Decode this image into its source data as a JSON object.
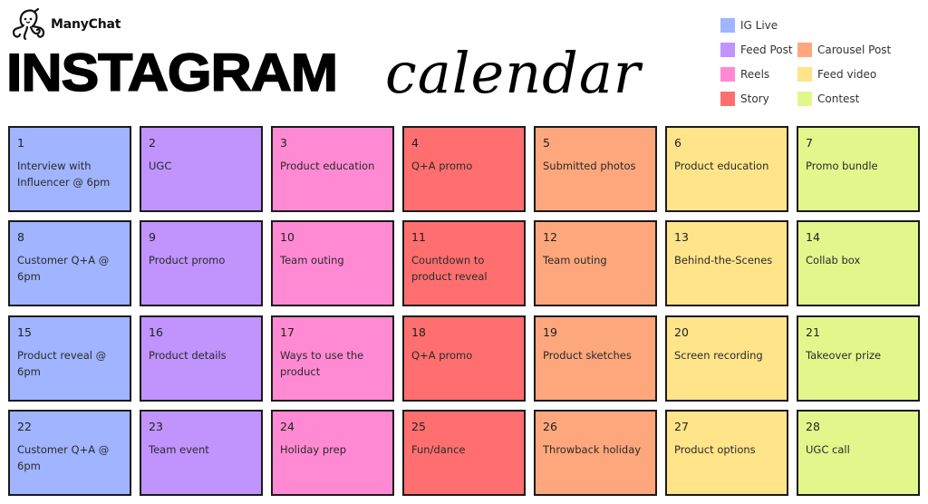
{
  "brand": {
    "name": "ManyChat"
  },
  "title": {
    "main": "INSTAGRAM",
    "script": "calendar"
  },
  "legend": [
    {
      "label": "IG Live",
      "color": "#a0b4ff",
      "col": 0,
      "row": 0
    },
    {
      "label": "Feed Post",
      "color": "#c093fd",
      "col": 0,
      "row": 1
    },
    {
      "label": "Reels",
      "color": "#ff8ad3",
      "col": 0,
      "row": 2
    },
    {
      "label": "Story",
      "color": "#ff6f6f",
      "col": 0,
      "row": 3
    },
    {
      "label": "Carousel Post",
      "color": "#ffa77c",
      "col": 1,
      "row": 1
    },
    {
      "label": "Feed video",
      "color": "#ffe48a",
      "col": 1,
      "row": 2
    },
    {
      "label": "Contest",
      "color": "#e1f78c",
      "col": 1,
      "row": 3
    }
  ],
  "columns": [
    {
      "type": "IG Live",
      "color": "#a0b4ff"
    },
    {
      "type": "Feed Post",
      "color": "#c093fd"
    },
    {
      "type": "Reels",
      "color": "#ff8ad3"
    },
    {
      "type": "Story",
      "color": "#ff6f6f"
    },
    {
      "type": "Carousel Post",
      "color": "#ffa77c"
    },
    {
      "type": "Feed video",
      "color": "#ffe48a"
    },
    {
      "type": "Contest",
      "color": "#e1f78c"
    }
  ],
  "days": [
    {
      "day": "1",
      "text": "Interview with Influencer @ 6pm"
    },
    {
      "day": "2",
      "text": "UGC"
    },
    {
      "day": "3",
      "text": "Product education"
    },
    {
      "day": "4",
      "text": "Q+A promo"
    },
    {
      "day": "5",
      "text": "Submitted photos"
    },
    {
      "day": "6",
      "text": "Product education"
    },
    {
      "day": "7",
      "text": "Promo bundle"
    },
    {
      "day": "8",
      "text": "Customer Q+A @ 6pm"
    },
    {
      "day": "9",
      "text": "Product promo"
    },
    {
      "day": "10",
      "text": "Team outing"
    },
    {
      "day": "11",
      "text": "Countdown to product reveal"
    },
    {
      "day": "12",
      "text": "Team outing"
    },
    {
      "day": "13",
      "text": "Behind-the-Scenes"
    },
    {
      "day": "14",
      "text": "Collab box"
    },
    {
      "day": "15",
      "text": "Product reveal @ 6pm"
    },
    {
      "day": "16",
      "text": "Product details"
    },
    {
      "day": "17",
      "text": "Ways to use the product"
    },
    {
      "day": "18",
      "text": "Q+A promo"
    },
    {
      "day": "19",
      "text": "Product sketches"
    },
    {
      "day": "20",
      "text": "Screen recording"
    },
    {
      "day": "21",
      "text": "Takeover prize"
    },
    {
      "day": "22",
      "text": "Customer Q+A @ 6pm"
    },
    {
      "day": "23",
      "text": "Team event"
    },
    {
      "day": "24",
      "text": "Holiday prep"
    },
    {
      "day": "25",
      "text": "Fun/dance"
    },
    {
      "day": "26",
      "text": "Throwback holiday"
    },
    {
      "day": "27",
      "text": "Product options"
    },
    {
      "day": "28",
      "text": "UGC call"
    }
  ]
}
